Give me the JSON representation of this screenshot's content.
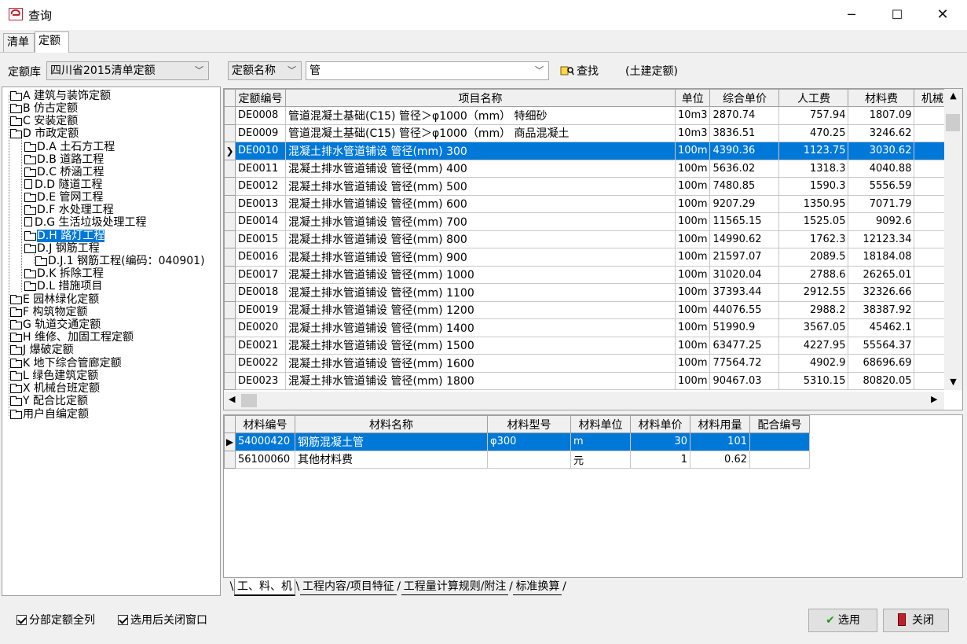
{
  "window": {
    "title": "查询",
    "icon": "app-logo-icon"
  },
  "tabs": [
    {
      "label": "清单"
    },
    {
      "label": "定额"
    }
  ],
  "toolbar": {
    "library_label": "定额库",
    "library_value": "四川省2015清单定额",
    "field_value": "定额名称",
    "query_value": "管",
    "find_label": "查找",
    "scope_label": "(土建定额)"
  },
  "tree": {
    "nodes": [
      {
        "label": "A 建筑与装饰定额"
      },
      {
        "label": "B 仿古定额"
      },
      {
        "label": "C 安装定额"
      },
      {
        "label": "D 市政定额"
      },
      {
        "label": "D.A 土石方工程"
      },
      {
        "label": "D.B 道路工程"
      },
      {
        "label": "D.C 桥涵工程"
      },
      {
        "label": "D.D 隧道工程"
      },
      {
        "label": "D.E 管网工程"
      },
      {
        "label": "D.F 水处理工程"
      },
      {
        "label": "D.G 生活垃圾处理工程"
      },
      {
        "label": "D.H 路灯工程"
      },
      {
        "label": "D.J 钢筋工程"
      },
      {
        "label": "D.J.1 钢筋工程(编码：040901)"
      },
      {
        "label": "D.K 拆除工程"
      },
      {
        "label": "D.L 措施项目"
      },
      {
        "label": "E 园林绿化定额"
      },
      {
        "label": "F 构筑物定额"
      },
      {
        "label": "G 轨道交通定额"
      },
      {
        "label": "H 维修、加固工程定额"
      },
      {
        "label": "J 爆破定额"
      },
      {
        "label": "K 地下综合管廊定额"
      },
      {
        "label": "L 绿色建筑定额"
      },
      {
        "label": "X 机械台班定额"
      },
      {
        "label": "Y 配合比定额"
      },
      {
        "label": "用户自编定额"
      }
    ]
  },
  "grid": {
    "columns": [
      "定额编号",
      "项目名称",
      "单位",
      "综合单价",
      "人工费",
      "材料费",
      "机械费"
    ],
    "rows": [
      {
        "code": "DE0008",
        "name": "管道混凝土基础(C15) 管径＞φ1000（mm） 特细砂",
        "unit": "10m3",
        "price": "2870.74",
        "labor": "757.94",
        "material": "1807.09"
      },
      {
        "code": "DE0009",
        "name": "管道混凝土基础(C15) 管径＞φ1000（mm） 商品混凝土",
        "unit": "10m3",
        "price": "3836.51",
        "labor": "470.25",
        "material": "3246.62"
      },
      {
        "code": "DE0010",
        "name": "混凝土排水管道铺设 管径(mm) 300",
        "unit": "100m",
        "price": "4390.36",
        "labor": "1123.75",
        "material": "3030.62"
      },
      {
        "code": "DE0011",
        "name": "混凝土排水管道铺设 管径(mm) 400",
        "unit": "100m",
        "price": "5636.02",
        "labor": "1318.3",
        "material": "4040.88"
      },
      {
        "code": "DE0012",
        "name": "混凝土排水管道铺设 管径(mm) 500",
        "unit": "100m",
        "price": "7480.85",
        "labor": "1590.3",
        "material": "5556.59"
      },
      {
        "code": "DE0013",
        "name": "混凝土排水管道铺设 管径(mm) 600",
        "unit": "100m",
        "price": "9207.29",
        "labor": "1350.95",
        "material": "7071.79"
      },
      {
        "code": "DE0014",
        "name": "混凝土排水管道铺设 管径(mm) 700",
        "unit": "100m",
        "price": "11565.15",
        "labor": "1525.05",
        "material": "9092.6"
      },
      {
        "code": "DE0015",
        "name": "混凝土排水管道铺设 管径(mm) 800",
        "unit": "100m",
        "price": "14990.62",
        "labor": "1762.3",
        "material": "12123.34"
      },
      {
        "code": "DE0016",
        "name": "混凝土排水管道铺设 管径(mm) 900",
        "unit": "100m",
        "price": "21597.07",
        "labor": "2089.5",
        "material": "18184.08"
      },
      {
        "code": "DE0017",
        "name": "混凝土排水管道铺设 管径(mm) 1000",
        "unit": "100m",
        "price": "31020.04",
        "labor": "2788.6",
        "material": "26265.01"
      },
      {
        "code": "DE0018",
        "name": "混凝土排水管道铺设 管径(mm) 1100",
        "unit": "100m",
        "price": "37393.44",
        "labor": "2912.55",
        "material": "32326.66"
      },
      {
        "code": "DE0019",
        "name": "混凝土排水管道铺设 管径(mm) 1200",
        "unit": "100m",
        "price": "44076.55",
        "labor": "2988.2",
        "material": "38387.92"
      },
      {
        "code": "DE0020",
        "name": "混凝土排水管道铺设 管径(mm) 1400",
        "unit": "100m",
        "price": "51990.9",
        "labor": "3567.05",
        "material": "45462.1"
      },
      {
        "code": "DE0021",
        "name": "混凝土排水管道铺设 管径(mm) 1500",
        "unit": "100m",
        "price": "63477.25",
        "labor": "4227.95",
        "material": "55564.37"
      },
      {
        "code": "DE0022",
        "name": "混凝土排水管道铺设 管径(mm) 1600",
        "unit": "100m",
        "price": "77564.72",
        "labor": "4902.9",
        "material": "68696.69"
      },
      {
        "code": "DE0023",
        "name": "混凝土排水管道铺设 管径(mm) 1800",
        "unit": "100m",
        "price": "90467.03",
        "labor": "5310.15",
        "material": "80820.05"
      }
    ]
  },
  "detail": {
    "columns": [
      "材料编号",
      "材料名称",
      "材料型号",
      "材料单位",
      "材料单价",
      "材料用量",
      "配合编号"
    ],
    "rows": [
      {
        "code": "54000420",
        "name": "钢筋混凝土管",
        "model": "φ300",
        "unit": "m",
        "price": "30",
        "qty": "101",
        "mix": ""
      },
      {
        "code": "56100060",
        "name": "其他材料费",
        "model": "",
        "unit": "元",
        "price": "1",
        "qty": "0.62",
        "mix": ""
      }
    ]
  },
  "bottom_tabs": [
    "工、料、机",
    "工程内容/项目特征",
    "工程量计算规则/附注",
    "标准换算"
  ],
  "footer": {
    "check_all_label": "分部定额全列",
    "check_close_label": "选用后关闭窗口",
    "select_label": "选用",
    "close_label": "关闭"
  },
  "colors": {
    "selection": "#0078d7",
    "accent_red": "#c0202c"
  }
}
